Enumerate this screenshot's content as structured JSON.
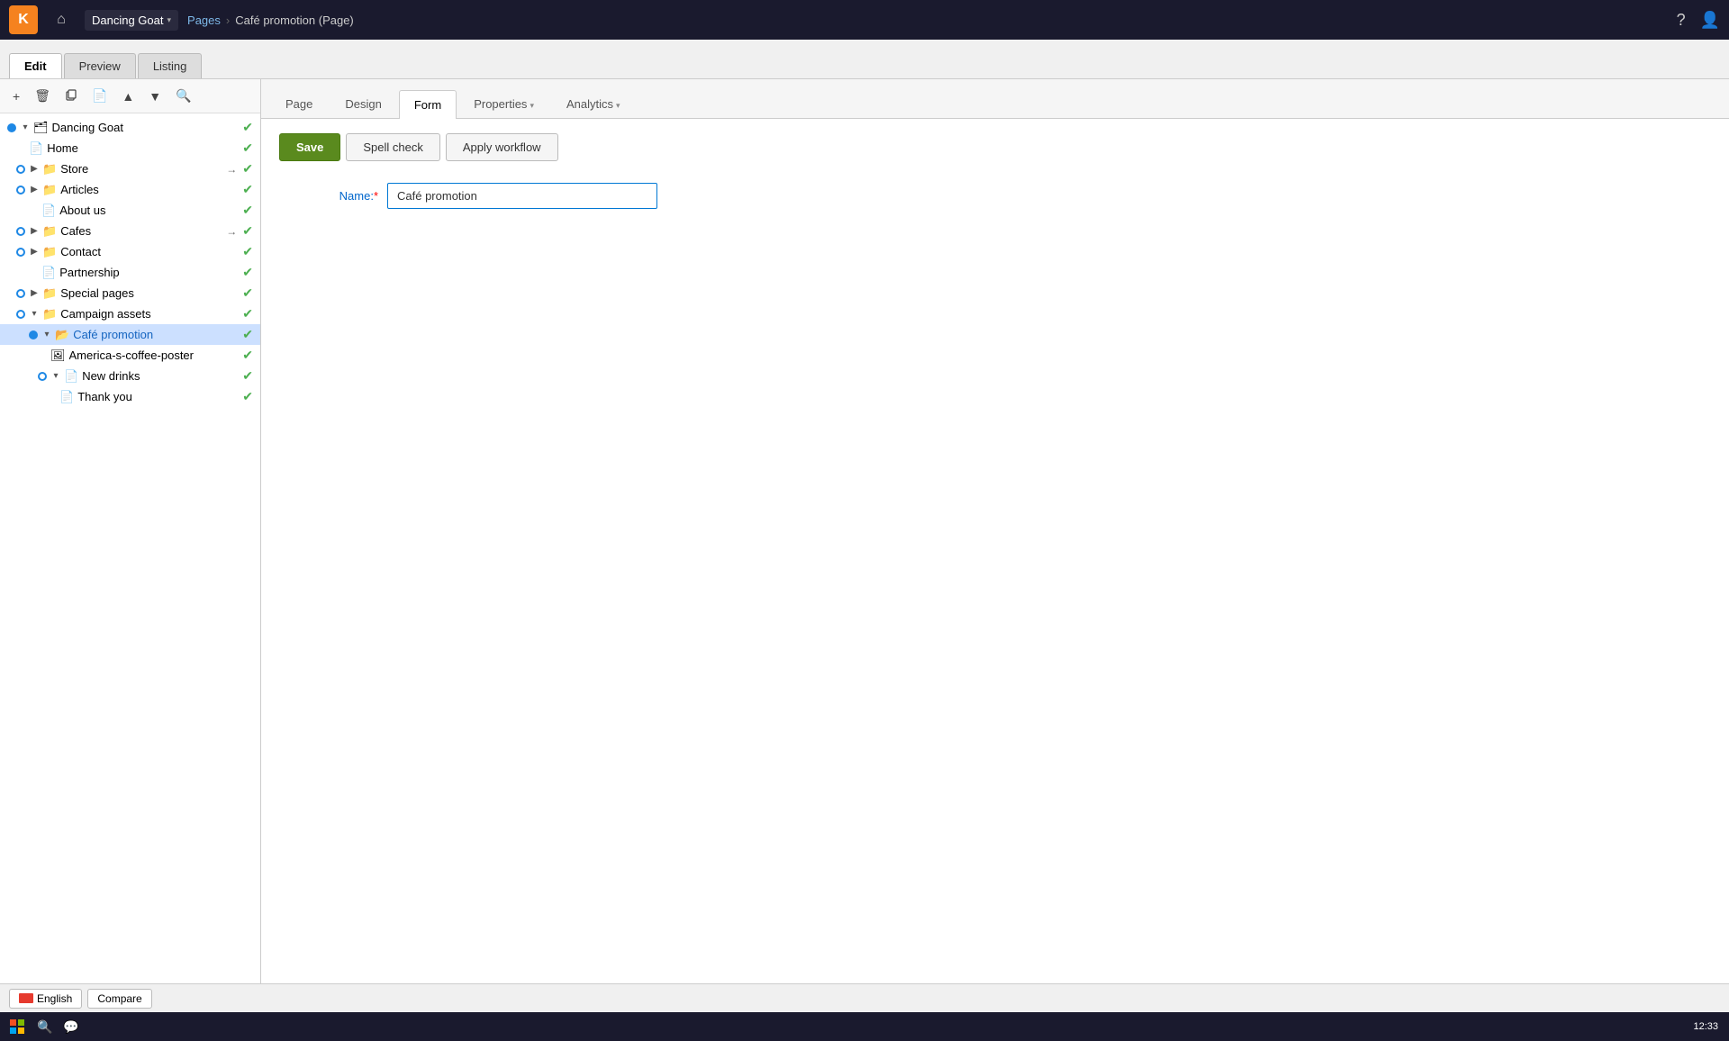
{
  "topbar": {
    "logo_text": "K",
    "site_name": "Dancing Goat",
    "breadcrumb_pages": "Pages",
    "breadcrumb_current": "Café promotion (Page)"
  },
  "mode_tabs": {
    "edit": "Edit",
    "preview": "Preview",
    "listing": "Listing"
  },
  "sidebar_toolbar": {
    "add": "+",
    "delete": "🗑",
    "copy": "📋",
    "paste": "📄",
    "up": "▲",
    "down": "▼",
    "search": "🔍"
  },
  "tree": [
    {
      "id": "dancing-goat",
      "label": "Dancing Goat",
      "level": 0,
      "type": "root",
      "expanded": true,
      "circle": "blue",
      "status": true
    },
    {
      "id": "home",
      "label": "Home",
      "level": 1,
      "type": "page",
      "status": true
    },
    {
      "id": "store",
      "label": "Store",
      "level": 1,
      "type": "folder",
      "expanded": false,
      "circle": "blue",
      "arrow": true,
      "status": true
    },
    {
      "id": "articles",
      "label": "Articles",
      "level": 1,
      "type": "folder",
      "expanded": false,
      "circle": "blue",
      "status": true
    },
    {
      "id": "about-us",
      "label": "About us",
      "level": 2,
      "type": "page",
      "status": true
    },
    {
      "id": "cafes",
      "label": "Cafes",
      "level": 1,
      "type": "folder",
      "expanded": false,
      "circle": "blue",
      "arrow": true,
      "status": true
    },
    {
      "id": "contact",
      "label": "Contact",
      "level": 1,
      "type": "folder",
      "expanded": false,
      "circle": "blue",
      "status": true
    },
    {
      "id": "partnership",
      "label": "Partnership",
      "level": 2,
      "type": "page",
      "status": true
    },
    {
      "id": "special-pages",
      "label": "Special pages",
      "level": 1,
      "type": "folder",
      "expanded": false,
      "circle": "blue",
      "status": true
    },
    {
      "id": "campaign-assets",
      "label": "Campaign assets",
      "level": 1,
      "type": "folder",
      "expanded": true,
      "circle": "blue",
      "status": true
    },
    {
      "id": "cafe-promotion",
      "label": "Café promotion",
      "level": 2,
      "type": "folder-open",
      "expanded": true,
      "circle": "blue-fill",
      "selected": true,
      "status": true
    },
    {
      "id": "america-coffee",
      "label": "America-s-coffee-poster",
      "level": 3,
      "type": "image",
      "status": true
    },
    {
      "id": "new-drinks",
      "label": "New drinks",
      "level": 3,
      "type": "page",
      "expanded": true,
      "circle": "blue",
      "status": true
    },
    {
      "id": "thank-you",
      "label": "Thank you",
      "level": 4,
      "type": "page",
      "status": true
    }
  ],
  "page_tabs": [
    {
      "id": "page",
      "label": "Page",
      "active": false
    },
    {
      "id": "design",
      "label": "Design",
      "active": false
    },
    {
      "id": "form",
      "label": "Form",
      "active": true
    },
    {
      "id": "properties",
      "label": "Properties",
      "active": false,
      "arrow": true
    },
    {
      "id": "analytics",
      "label": "Analytics",
      "active": false,
      "arrow": true
    }
  ],
  "action_buttons": {
    "save": "Save",
    "spell_check": "Spell check",
    "apply_workflow": "Apply workflow"
  },
  "form": {
    "name_label": "Name:",
    "name_required": "*",
    "name_value": "Café promotion"
  },
  "bottom_bar": {
    "language": "English",
    "compare": "Compare"
  },
  "taskbar": {
    "time": "12:33"
  }
}
